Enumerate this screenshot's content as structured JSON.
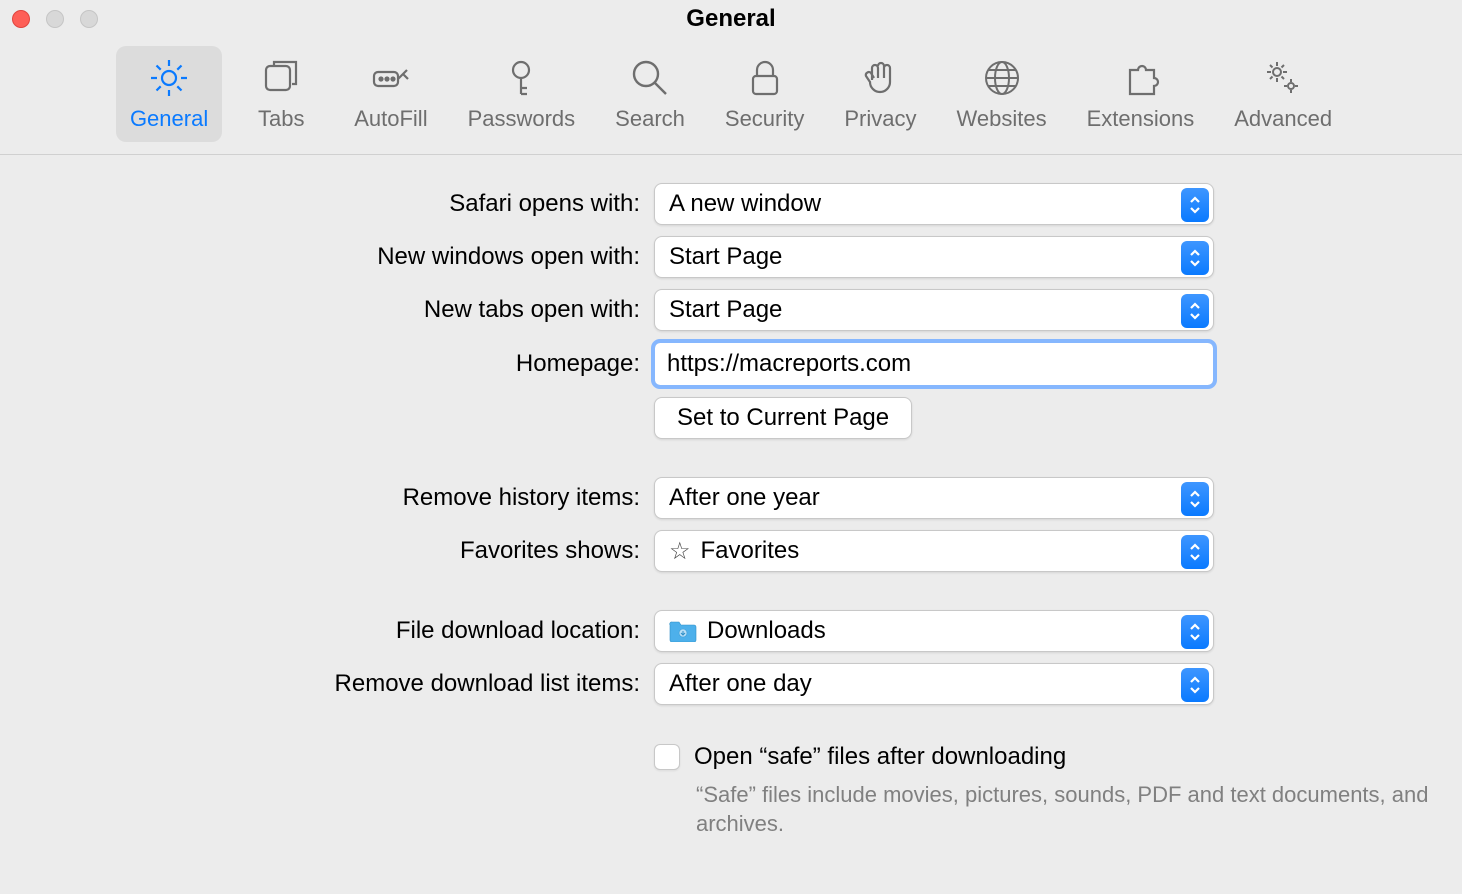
{
  "window": {
    "title": "General"
  },
  "toolbar": {
    "items": [
      {
        "id": "general",
        "label": "General",
        "active": true
      },
      {
        "id": "tabs",
        "label": "Tabs",
        "active": false
      },
      {
        "id": "autofill",
        "label": "AutoFill",
        "active": false
      },
      {
        "id": "passwords",
        "label": "Passwords",
        "active": false
      },
      {
        "id": "search",
        "label": "Search",
        "active": false
      },
      {
        "id": "security",
        "label": "Security",
        "active": false
      },
      {
        "id": "privacy",
        "label": "Privacy",
        "active": false
      },
      {
        "id": "websites",
        "label": "Websites",
        "active": false
      },
      {
        "id": "extensions",
        "label": "Extensions",
        "active": false
      },
      {
        "id": "advanced",
        "label": "Advanced",
        "active": false
      }
    ]
  },
  "settings": {
    "safari_opens_with": {
      "label": "Safari opens with:",
      "value": "A new window"
    },
    "new_windows_open_with": {
      "label": "New windows open with:",
      "value": "Start Page"
    },
    "new_tabs_open_with": {
      "label": "New tabs open with:",
      "value": "Start Page"
    },
    "homepage": {
      "label": "Homepage:",
      "value": "https://macreports.com"
    },
    "set_to_current": {
      "label": "Set to Current Page"
    },
    "remove_history_items": {
      "label": "Remove history items:",
      "value": "After one year"
    },
    "favorites_shows": {
      "label": "Favorites shows:",
      "value": "Favorites"
    },
    "file_download_location": {
      "label": "File download location:",
      "value": "Downloads"
    },
    "remove_download_list_items": {
      "label": "Remove download list items:",
      "value": "After one day"
    },
    "open_safe_files": {
      "label": "Open “safe” files after downloading",
      "checked": false
    },
    "safe_help": "“Safe” files include movies, pictures, sounds, PDF and text documents, and archives."
  }
}
